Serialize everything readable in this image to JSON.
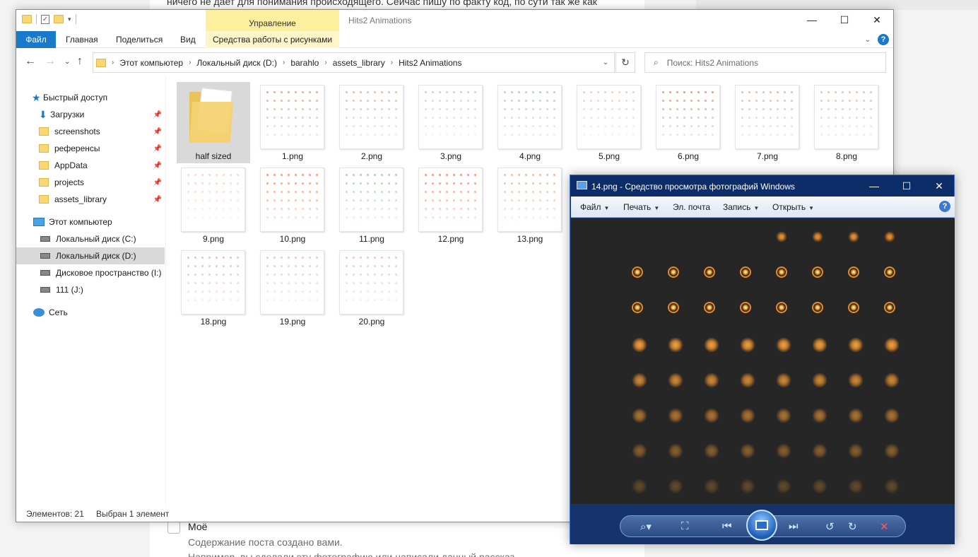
{
  "background": {
    "top_text": "ничего не дает для понимания происходящего. Сейчас пишу по факту код, по сути так же как",
    "checkbox_label": "Моё",
    "line1": "Содержание поста создано вами.",
    "line2": "Например, вы сделали эту фотографию или написали данный рассказ."
  },
  "explorer": {
    "manage_context": "Управление",
    "title": "Hits2 Animations",
    "ribbon_tabs": [
      "Файл",
      "Главная",
      "Поделиться",
      "Вид",
      "Средства работы с рисунками"
    ],
    "breadcrumb": [
      "Этот компьютер",
      "Локальный диск (D:)",
      "barahlo",
      "assets_library",
      "Hits2 Animations"
    ],
    "search_placeholder": "Поиск: Hits2 Animations",
    "sidebar": {
      "quick_access": "Быстрый доступ",
      "quick_items": [
        "Загрузки",
        "screenshots",
        "референсы",
        "AppData",
        "projects",
        "assets_library"
      ],
      "this_pc": "Этот компьютер",
      "drives": [
        "Локальный диск (C:)",
        "Локальный диск (D:)",
        "Дисковое пространство (I:)",
        "111 (J:)"
      ],
      "network": "Сеть"
    },
    "files": [
      "half sized",
      "1.png",
      "2.png",
      "3.png",
      "4.png",
      "5.png",
      "6.png",
      "7.png",
      "8.png",
      "9.png",
      "10.png",
      "11.png",
      "12.png",
      "13.png",
      "18.png",
      "19.png",
      "20.png"
    ],
    "status_count": "Элементов: 21",
    "status_selected": "Выбран 1 элемент"
  },
  "viewer": {
    "title": "14.png - Средство просмотра фотографий Windows",
    "menu": [
      "Файл",
      "Печать",
      "Эл. почта",
      "Запись",
      "Открыть"
    ],
    "help": "?"
  },
  "colors": {
    "ribbon_blue": "#1979ca",
    "manage_yellow": "#fcef9d",
    "viewer_title": "#0c2d67",
    "viewer_bg": "#262626",
    "sprite_orange": "#e58a2a"
  }
}
